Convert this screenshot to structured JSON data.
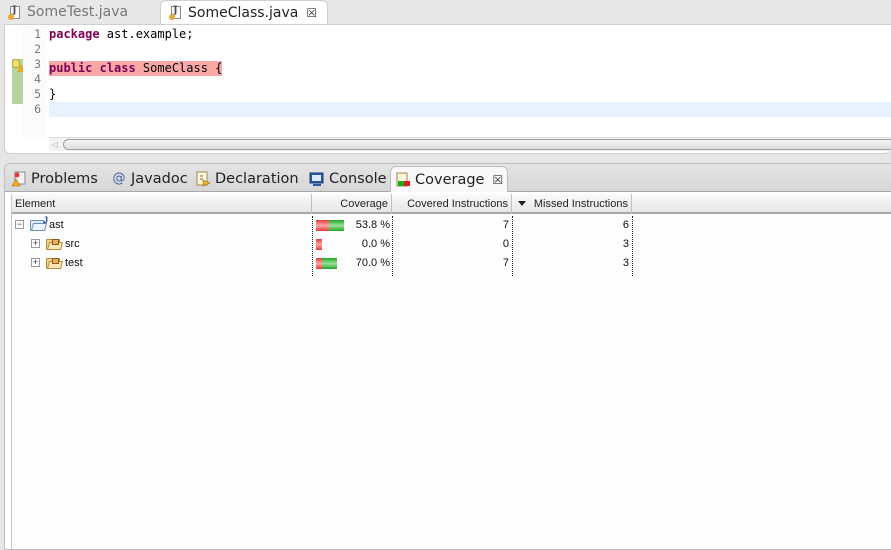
{
  "editor": {
    "tabs": [
      {
        "label": "SomeTest.java",
        "active": false
      },
      {
        "label": "SomeClass.java",
        "active": true,
        "close_glyph": "☒"
      }
    ],
    "line_numbers": [
      "1",
      "2",
      "3",
      "4",
      "5",
      "6"
    ],
    "lines": [
      {
        "keyword": "package",
        "rest": " ast.example;",
        "status": "none"
      },
      {
        "keyword": "",
        "rest": "",
        "status": "none"
      },
      {
        "keyword": "public class",
        "rest": " SomeClass {",
        "status": "missed"
      },
      {
        "keyword": "",
        "rest": "",
        "status": "none"
      },
      {
        "keyword": "",
        "rest": "}",
        "status": "none"
      },
      {
        "keyword": "",
        "rest": "",
        "status": "current"
      }
    ],
    "markers": [
      {
        "line": 3,
        "icon": "warning-lightbulb-icon"
      }
    ]
  },
  "panel": {
    "tabs": [
      {
        "label": "Problems",
        "icon": "problems-icon",
        "active": false
      },
      {
        "label": "Javadoc",
        "icon": "at-icon",
        "active": false
      },
      {
        "label": "Declaration",
        "icon": "declaration-icon",
        "active": false
      },
      {
        "label": "Console",
        "icon": "console-icon",
        "active": false
      },
      {
        "label": "Coverage",
        "icon": "coverage-icon",
        "active": true,
        "close_glyph": "☒"
      }
    ],
    "coverage": {
      "columns": [
        "Element",
        "Coverage",
        "Covered Instructions",
        "Missed Instructions"
      ],
      "sort_column": "Missed Instructions",
      "sort_direction": "descending",
      "colors": {
        "covered": "#23a623",
        "missed": "#e83a3a"
      },
      "rows": [
        {
          "element": "ast",
          "type": "project",
          "expanded": true,
          "expander": "−",
          "depth": 0,
          "coverage": "53.8 %",
          "covered": 7,
          "missed": 6
        },
        {
          "element": "src",
          "type": "source-folder",
          "expanded": false,
          "expander": "+",
          "depth": 1,
          "coverage": "0.0 %",
          "covered": 0,
          "missed": 3
        },
        {
          "element": "test",
          "type": "source-folder",
          "expanded": false,
          "expander": "+",
          "depth": 1,
          "coverage": "70.0 %",
          "covered": 7,
          "missed": 3
        }
      ]
    }
  }
}
